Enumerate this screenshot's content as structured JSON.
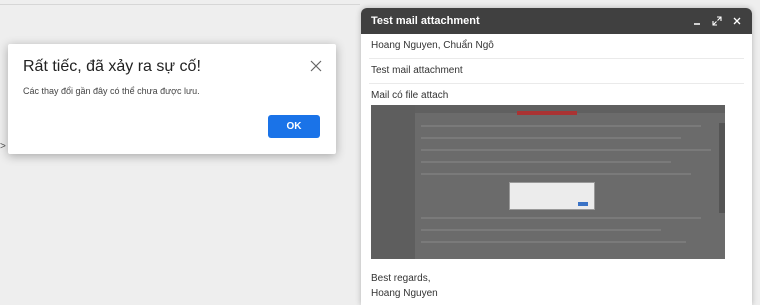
{
  "compose": {
    "title": "Test mail attachment",
    "recipients": "Hoang Nguyen, Chuẩn Ngô",
    "subject": "Test mail attachment",
    "body_intro": "Mail có file attach",
    "signoff_1": "Best regards,",
    "signoff_2": "Hoang Nguyen"
  },
  "dialog": {
    "title": "Rất tiếc, đã xảy ra sự cố!",
    "message": "Các thay đổi gần đây có thể chưa được lưu.",
    "ok_label": "OK"
  },
  "background": {
    "arrow": ">"
  },
  "colors": {
    "header_bg": "#404040",
    "ok_button": "#1a73e8"
  },
  "icons": [
    "minimize-icon",
    "expand-icon",
    "close-icon",
    "dialog-close-icon"
  ]
}
